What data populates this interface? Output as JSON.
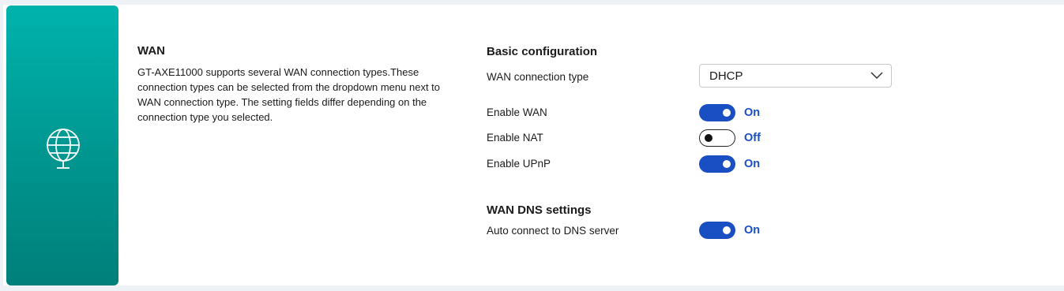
{
  "info": {
    "title": "WAN",
    "description": "GT-AXE11000 supports several WAN connection types.These connection types can be selected from the dropdown menu next to WAN connection type. The setting fields differ depending on the connection type you selected.",
    "icon": "globe-icon"
  },
  "basic_config": {
    "title": "Basic configuration",
    "wan_connection_type": {
      "label": "WAN connection type",
      "selected": "DHCP"
    },
    "enable_wan": {
      "label": "Enable WAN",
      "state": "On"
    },
    "enable_nat": {
      "label": "Enable NAT",
      "state": "Off"
    },
    "enable_upnp": {
      "label": "Enable UPnP",
      "state": "On"
    }
  },
  "dns_settings": {
    "title": "WAN DNS settings",
    "auto_connect": {
      "label": "Auto connect to DNS server",
      "state": "On"
    }
  },
  "colors": {
    "accent": "#1a4fc4",
    "panel_top": "#00b3ad",
    "panel_bottom": "#007f7a"
  }
}
